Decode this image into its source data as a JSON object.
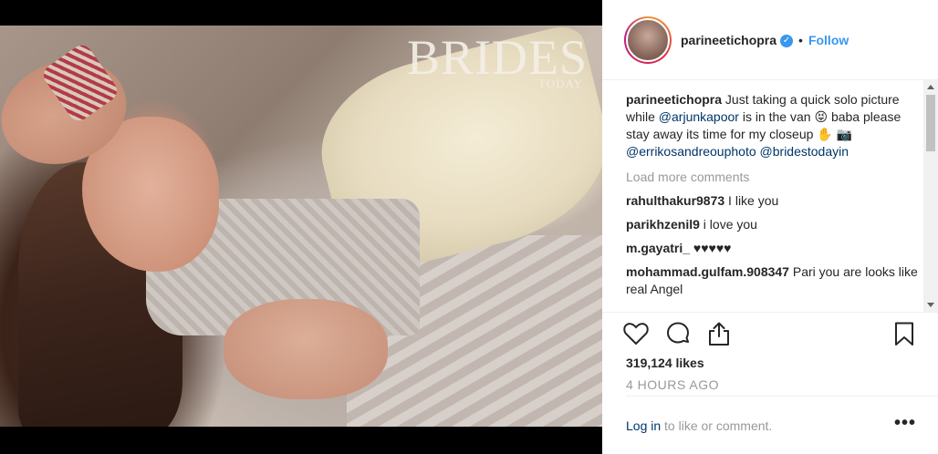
{
  "photo": {
    "magazine_title": "BRIDES",
    "magazine_subtitle": "TODAY"
  },
  "header": {
    "username": "parineetichopra",
    "verified_icon": "verified-badge-icon",
    "separator": "•",
    "follow_label": "Follow"
  },
  "caption": {
    "username": "parineetichopra",
    "text_1": " Just taking a quick solo picture while ",
    "mention_1": "@arjunkapoor",
    "text_2": " is in the van ",
    "emoji_1": "😝",
    "text_3": " baba please stay away its time for my closeup ",
    "emoji_2": "✋",
    "emoji_3": "📷",
    "text_4": " ",
    "mention_2": "@erriko­sandreouphoto",
    "mention_2_display": "@errikosandreouphoto",
    "text_5": " ",
    "mention_3": "@bridestodayin"
  },
  "load_more": "Load more comments",
  "comments": [
    {
      "username": "rahulthakur9873",
      "text": " I like you"
    },
    {
      "username": "parikhzenil9",
      "text": " i love you"
    },
    {
      "username": "m.gayatri_",
      "text": " ♥♥♥♥♥"
    },
    {
      "username": "mohammad.gulfam.908347",
      "text": " Pari you are looks like real Angel"
    }
  ],
  "actions": {
    "like_icon": "heart-icon",
    "comment_icon": "comment-icon",
    "share_icon": "share-icon",
    "save_icon": "bookmark-icon"
  },
  "likes": "319,124 likes",
  "timestamp": "4 HOURS AGO",
  "footer": {
    "login_label": "Log in",
    "login_suffix": " to like or comment.",
    "more_label": "•••"
  },
  "colors": {
    "accent": "#3897f0",
    "mention": "#003569",
    "muted": "#999999"
  }
}
